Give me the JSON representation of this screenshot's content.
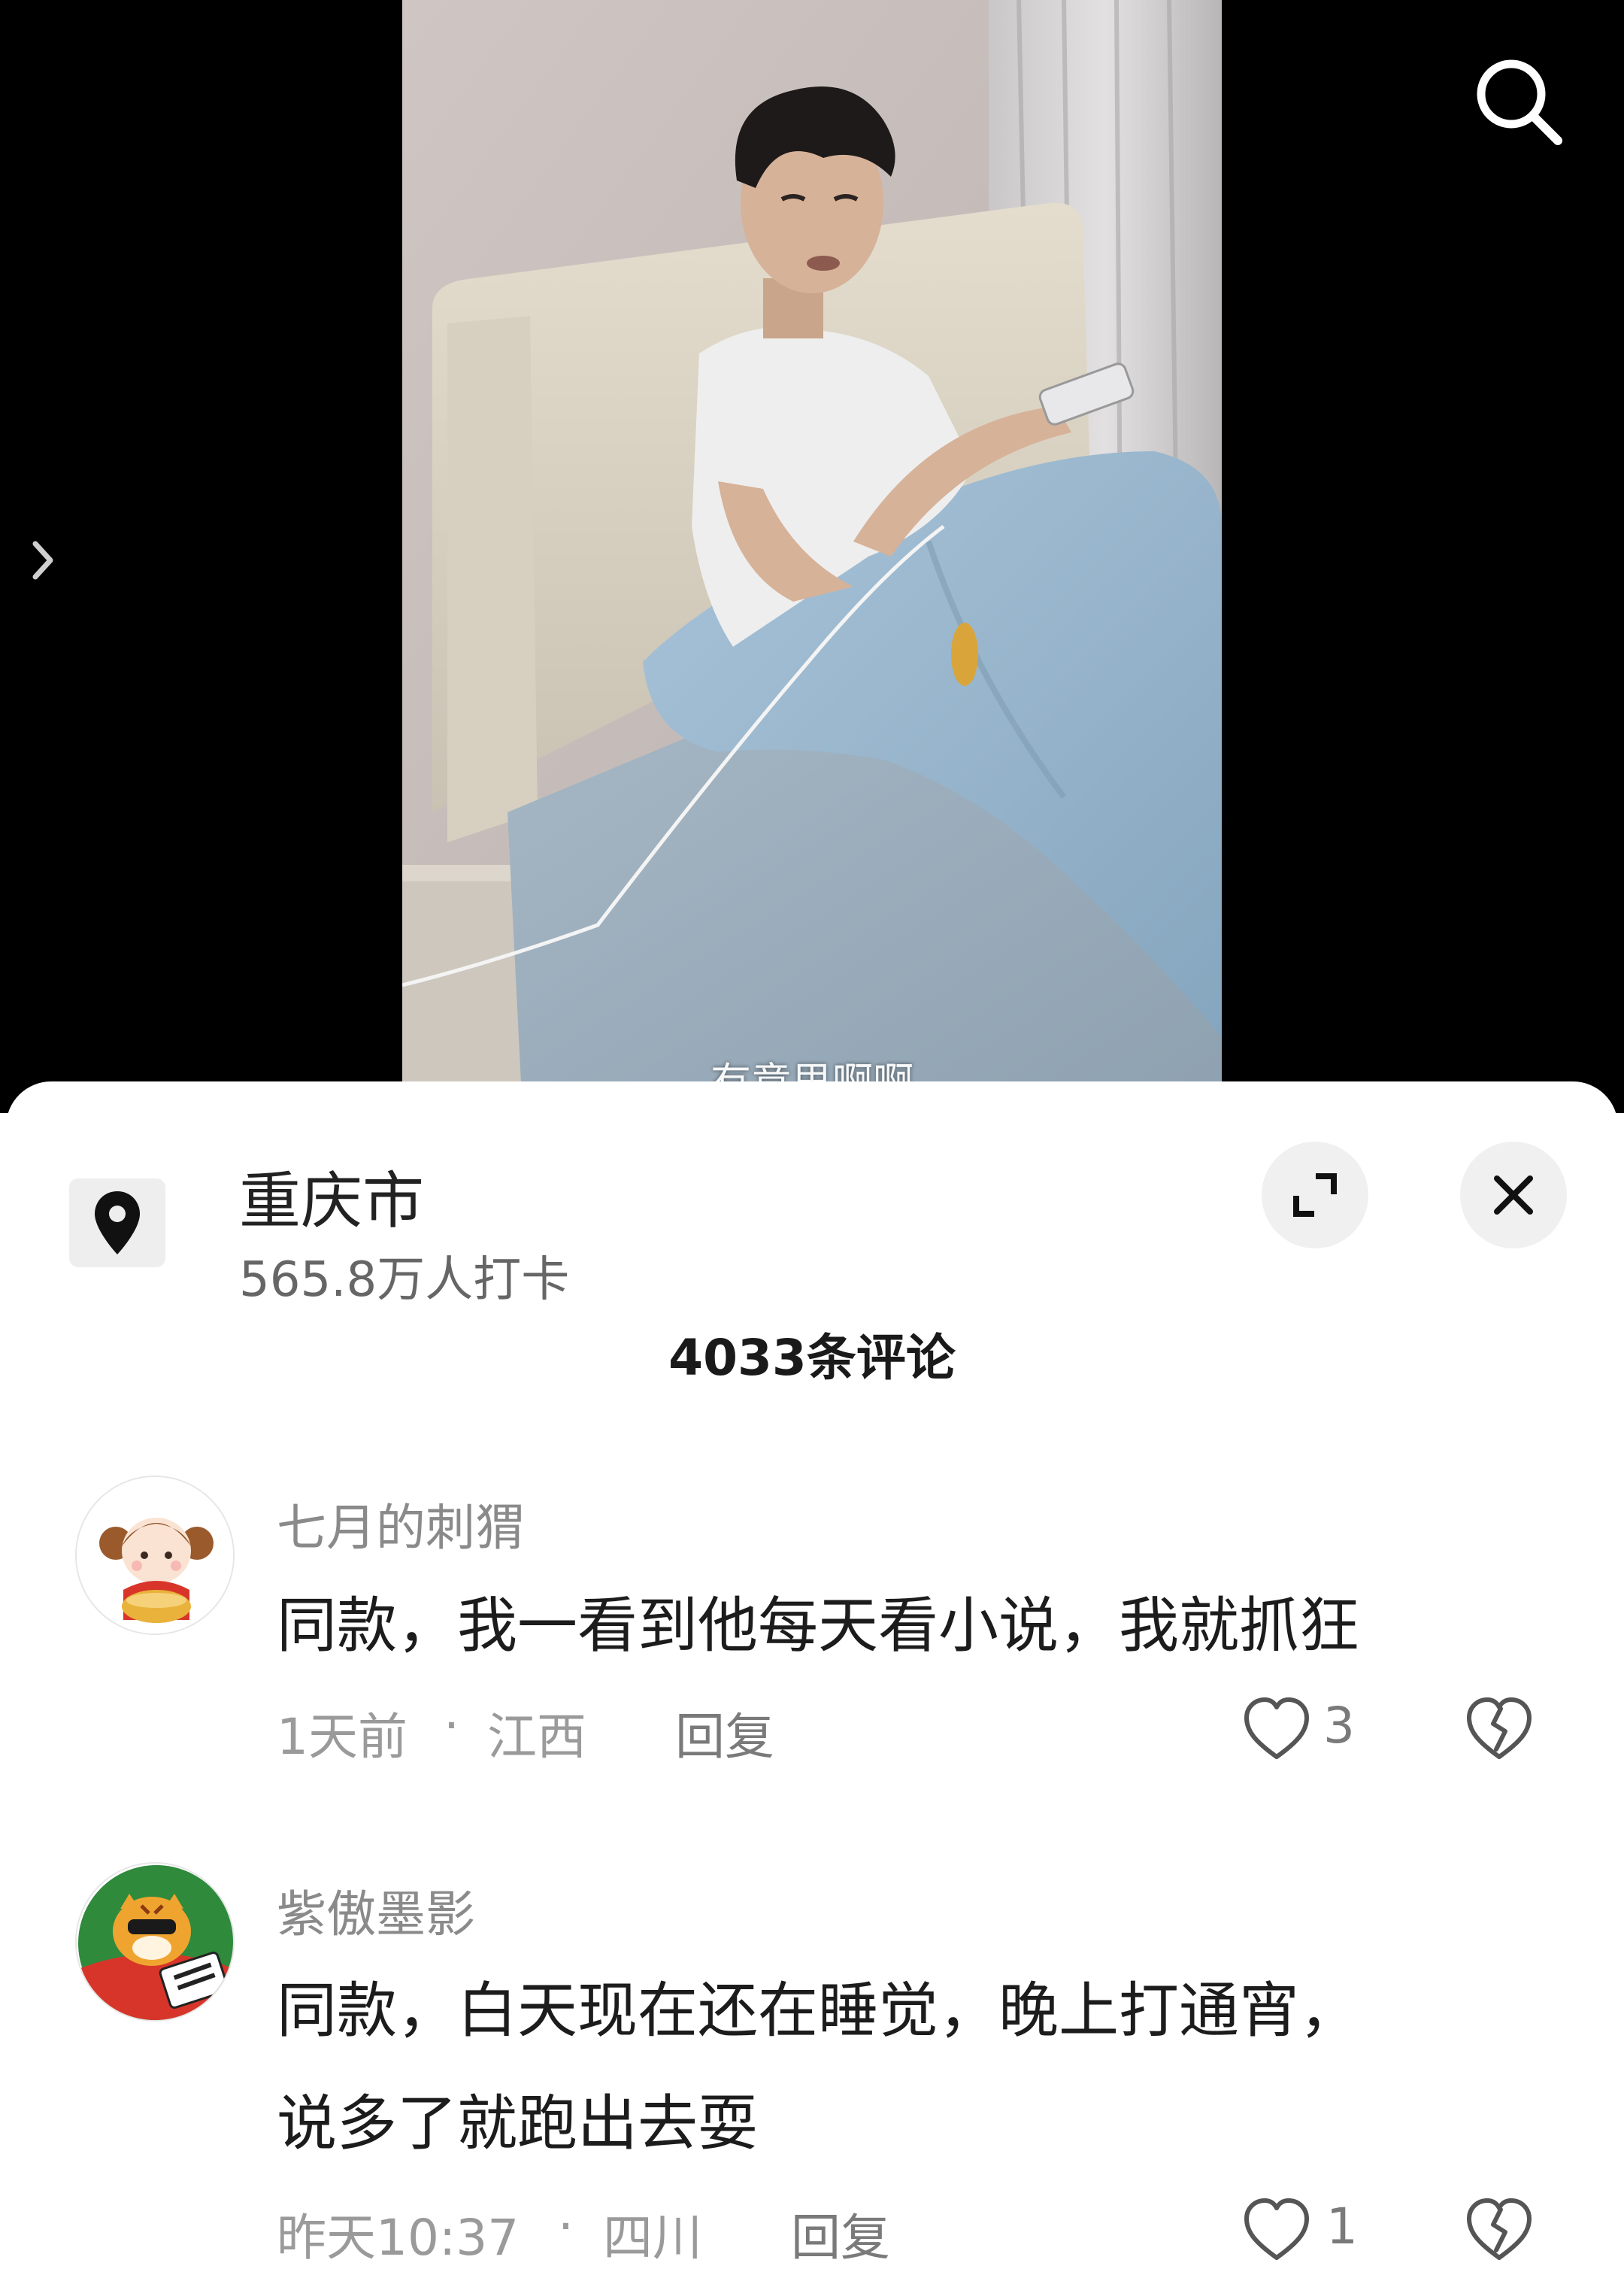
{
  "video": {
    "subtitle": "有意思啊啊"
  },
  "icons": {
    "search": "search-icon",
    "chevron": "chevron-right-icon",
    "location": "location-pin-icon",
    "expand": "expand-icon",
    "close": "close-icon",
    "like": "heart-outline-icon",
    "dislike": "broken-heart-icon"
  },
  "location": {
    "name": "重庆市",
    "checkins": "565.8万人打卡"
  },
  "comments_header": {
    "count_label": "4033条评论"
  },
  "comments": [
    {
      "user": "七月的刺猬",
      "text_lines": [
        "同款，我一看到他每天看小说，我就抓狂"
      ],
      "time": "1天前",
      "separator": "·",
      "region": "江西",
      "reply_label": "回复",
      "likes": "3"
    },
    {
      "user": "紫傲墨影",
      "text_lines": [
        "同款，白天现在还在睡觉，晚上打通宵，",
        "说多了就跑出去耍"
      ],
      "time": "昨天10:37",
      "separator": "·",
      "region": "四川",
      "reply_label": "回复",
      "likes": "1"
    }
  ],
  "colors": {
    "sheet_bg": "#ffffff",
    "video_bg": "#000000",
    "muted_text": "#8a8a8a",
    "primary_text": "#1c1c1c",
    "button_bg": "#f0f0f0"
  }
}
